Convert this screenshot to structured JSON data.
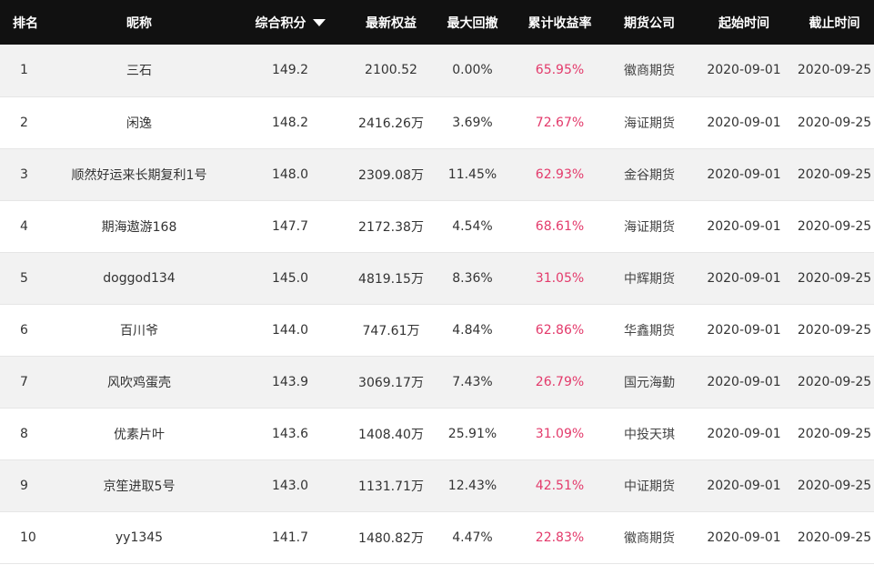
{
  "headers": {
    "rank": "排名",
    "nickname": "昵称",
    "score": "综合积分",
    "equity": "最新权益",
    "drawdown": "最大回撤",
    "return_rate": "累计收益率",
    "company": "期货公司",
    "start": "起始时间",
    "end": "截止时间"
  },
  "sort_icon": "triangle-down-icon",
  "colors": {
    "header_bg": "#111111",
    "return_rate": "#e33a6b",
    "row_alt": "#f2f2f2"
  },
  "rows": [
    {
      "rank": "1",
      "nickname": "三石",
      "score": "149.2",
      "equity": "2100.52",
      "drawdown": "0.00%",
      "return_rate": "65.95%",
      "company": "徽商期货",
      "start": "2020-09-01",
      "end": "2020-09-25"
    },
    {
      "rank": "2",
      "nickname": "闲逸",
      "score": "148.2",
      "equity": "2416.26万",
      "drawdown": "3.69%",
      "return_rate": "72.67%",
      "company": "海证期货",
      "start": "2020-09-01",
      "end": "2020-09-25"
    },
    {
      "rank": "3",
      "nickname": "顺然好运来长期复利1号",
      "score": "148.0",
      "equity": "2309.08万",
      "drawdown": "11.45%",
      "return_rate": "62.93%",
      "company": "金谷期货",
      "start": "2020-09-01",
      "end": "2020-09-25"
    },
    {
      "rank": "4",
      "nickname": "期海遨游168",
      "score": "147.7",
      "equity": "2172.38万",
      "drawdown": "4.54%",
      "return_rate": "68.61%",
      "company": "海证期货",
      "start": "2020-09-01",
      "end": "2020-09-25"
    },
    {
      "rank": "5",
      "nickname": "doggod134",
      "score": "145.0",
      "equity": "4819.15万",
      "drawdown": "8.36%",
      "return_rate": "31.05%",
      "company": "中辉期货",
      "start": "2020-09-01",
      "end": "2020-09-25"
    },
    {
      "rank": "6",
      "nickname": "百川爷",
      "score": "144.0",
      "equity": "747.61万",
      "drawdown": "4.84%",
      "return_rate": "62.86%",
      "company": "华鑫期货",
      "start": "2020-09-01",
      "end": "2020-09-25"
    },
    {
      "rank": "7",
      "nickname": "风吹鸡蛋壳",
      "score": "143.9",
      "equity": "3069.17万",
      "drawdown": "7.43%",
      "return_rate": "26.79%",
      "company": "国元海勤",
      "start": "2020-09-01",
      "end": "2020-09-25"
    },
    {
      "rank": "8",
      "nickname": "优素片叶",
      "score": "143.6",
      "equity": "1408.40万",
      "drawdown": "25.91%",
      "return_rate": "31.09%",
      "company": "中投天琪",
      "start": "2020-09-01",
      "end": "2020-09-25"
    },
    {
      "rank": "9",
      "nickname": "京笙进取5号",
      "score": "143.0",
      "equity": "1131.71万",
      "drawdown": "12.43%",
      "return_rate": "42.51%",
      "company": "中证期货",
      "start": "2020-09-01",
      "end": "2020-09-25"
    },
    {
      "rank": "10",
      "nickname": "yy1345",
      "score": "141.7",
      "equity": "1480.82万",
      "drawdown": "4.47%",
      "return_rate": "22.83%",
      "company": "徽商期货",
      "start": "2020-09-01",
      "end": "2020-09-25"
    }
  ]
}
